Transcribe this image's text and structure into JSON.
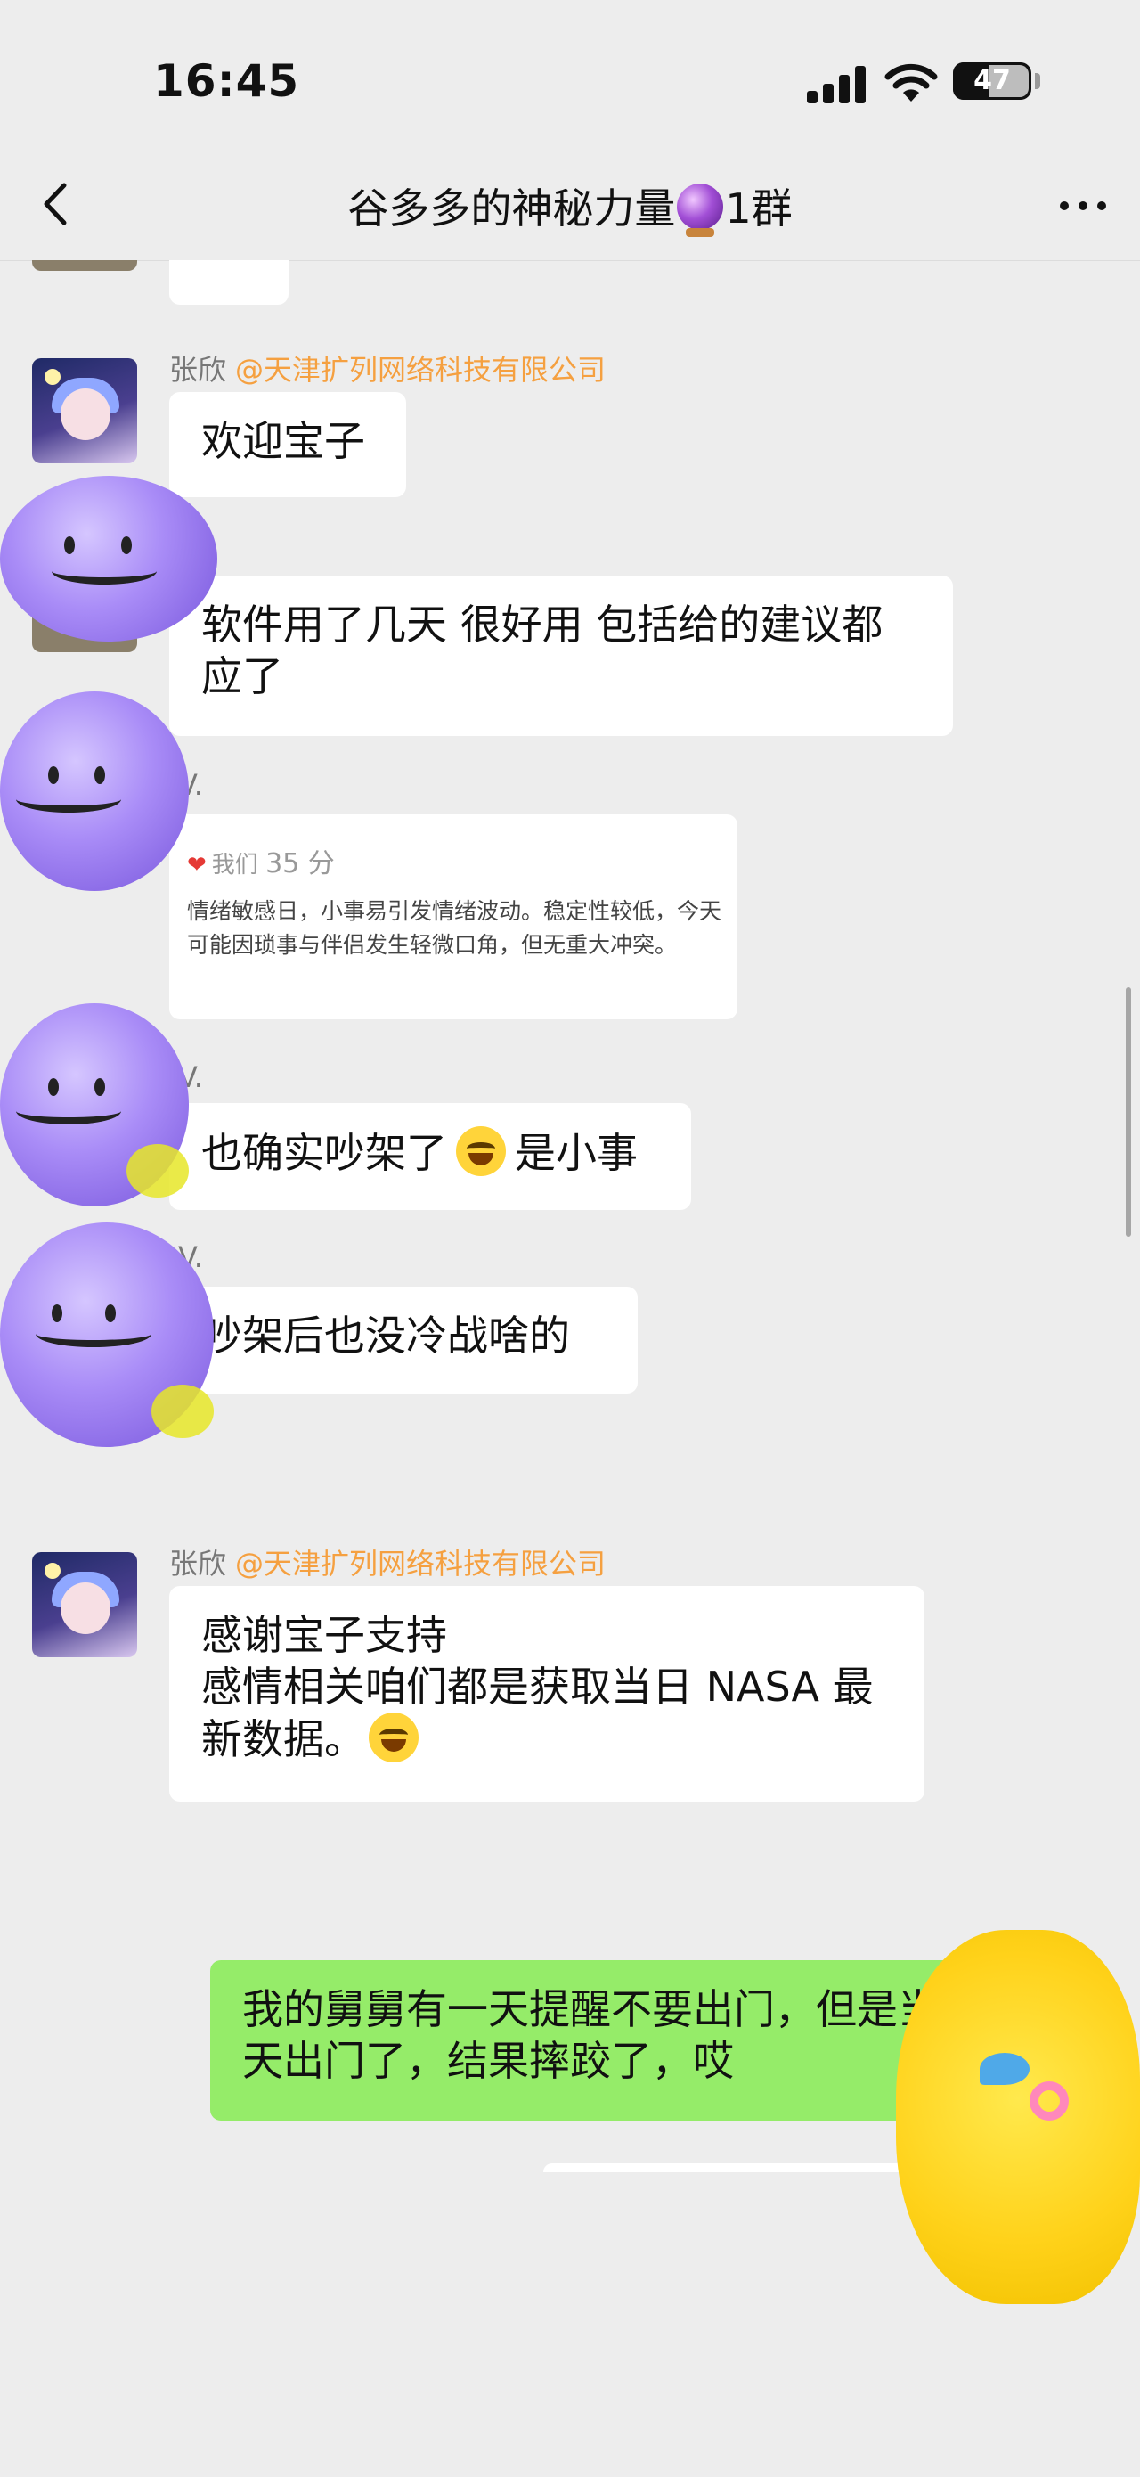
{
  "status_bar": {
    "time": "16:45",
    "battery": "47",
    "battery_level": 0.47
  },
  "nav": {
    "title_part1": "谷多多的神秘力量",
    "title_part2": "1群"
  },
  "messages": {
    "m1_sender": "张欣",
    "m1_org": "@天津扩列网络科技有限公司",
    "m1_text": "欢迎宝子",
    "m2_text": "软件用了几天 很好用 包括给的建议都应了",
    "m3_sender_partial": "V.",
    "card_label": "我们",
    "card_score": "35 分",
    "card_text": "情绪敏感日，小事易引发情绪波动。稳定性较低，今天可能因琐事与伴侣发生轻微口角，但无重大冲突。",
    "m4_sender_partial": "V.",
    "m4_text_a": "也确实吵架了",
    "m4_text_b": "是小事",
    "m5_sender_partial": "V.",
    "m5_text": "吵架后也没冷战啥的",
    "m6_sender": "张欣",
    "m6_org": "@天津扩列网络科技有限公司",
    "m6_line1": "感谢宝子支持",
    "m6_line2": "感情相关咱们都是获取当日 NASA 最新数据。",
    "m7_text": "我的舅舅有一天提醒不要出门，但是当天出门了，结果摔跤了，哎"
  }
}
